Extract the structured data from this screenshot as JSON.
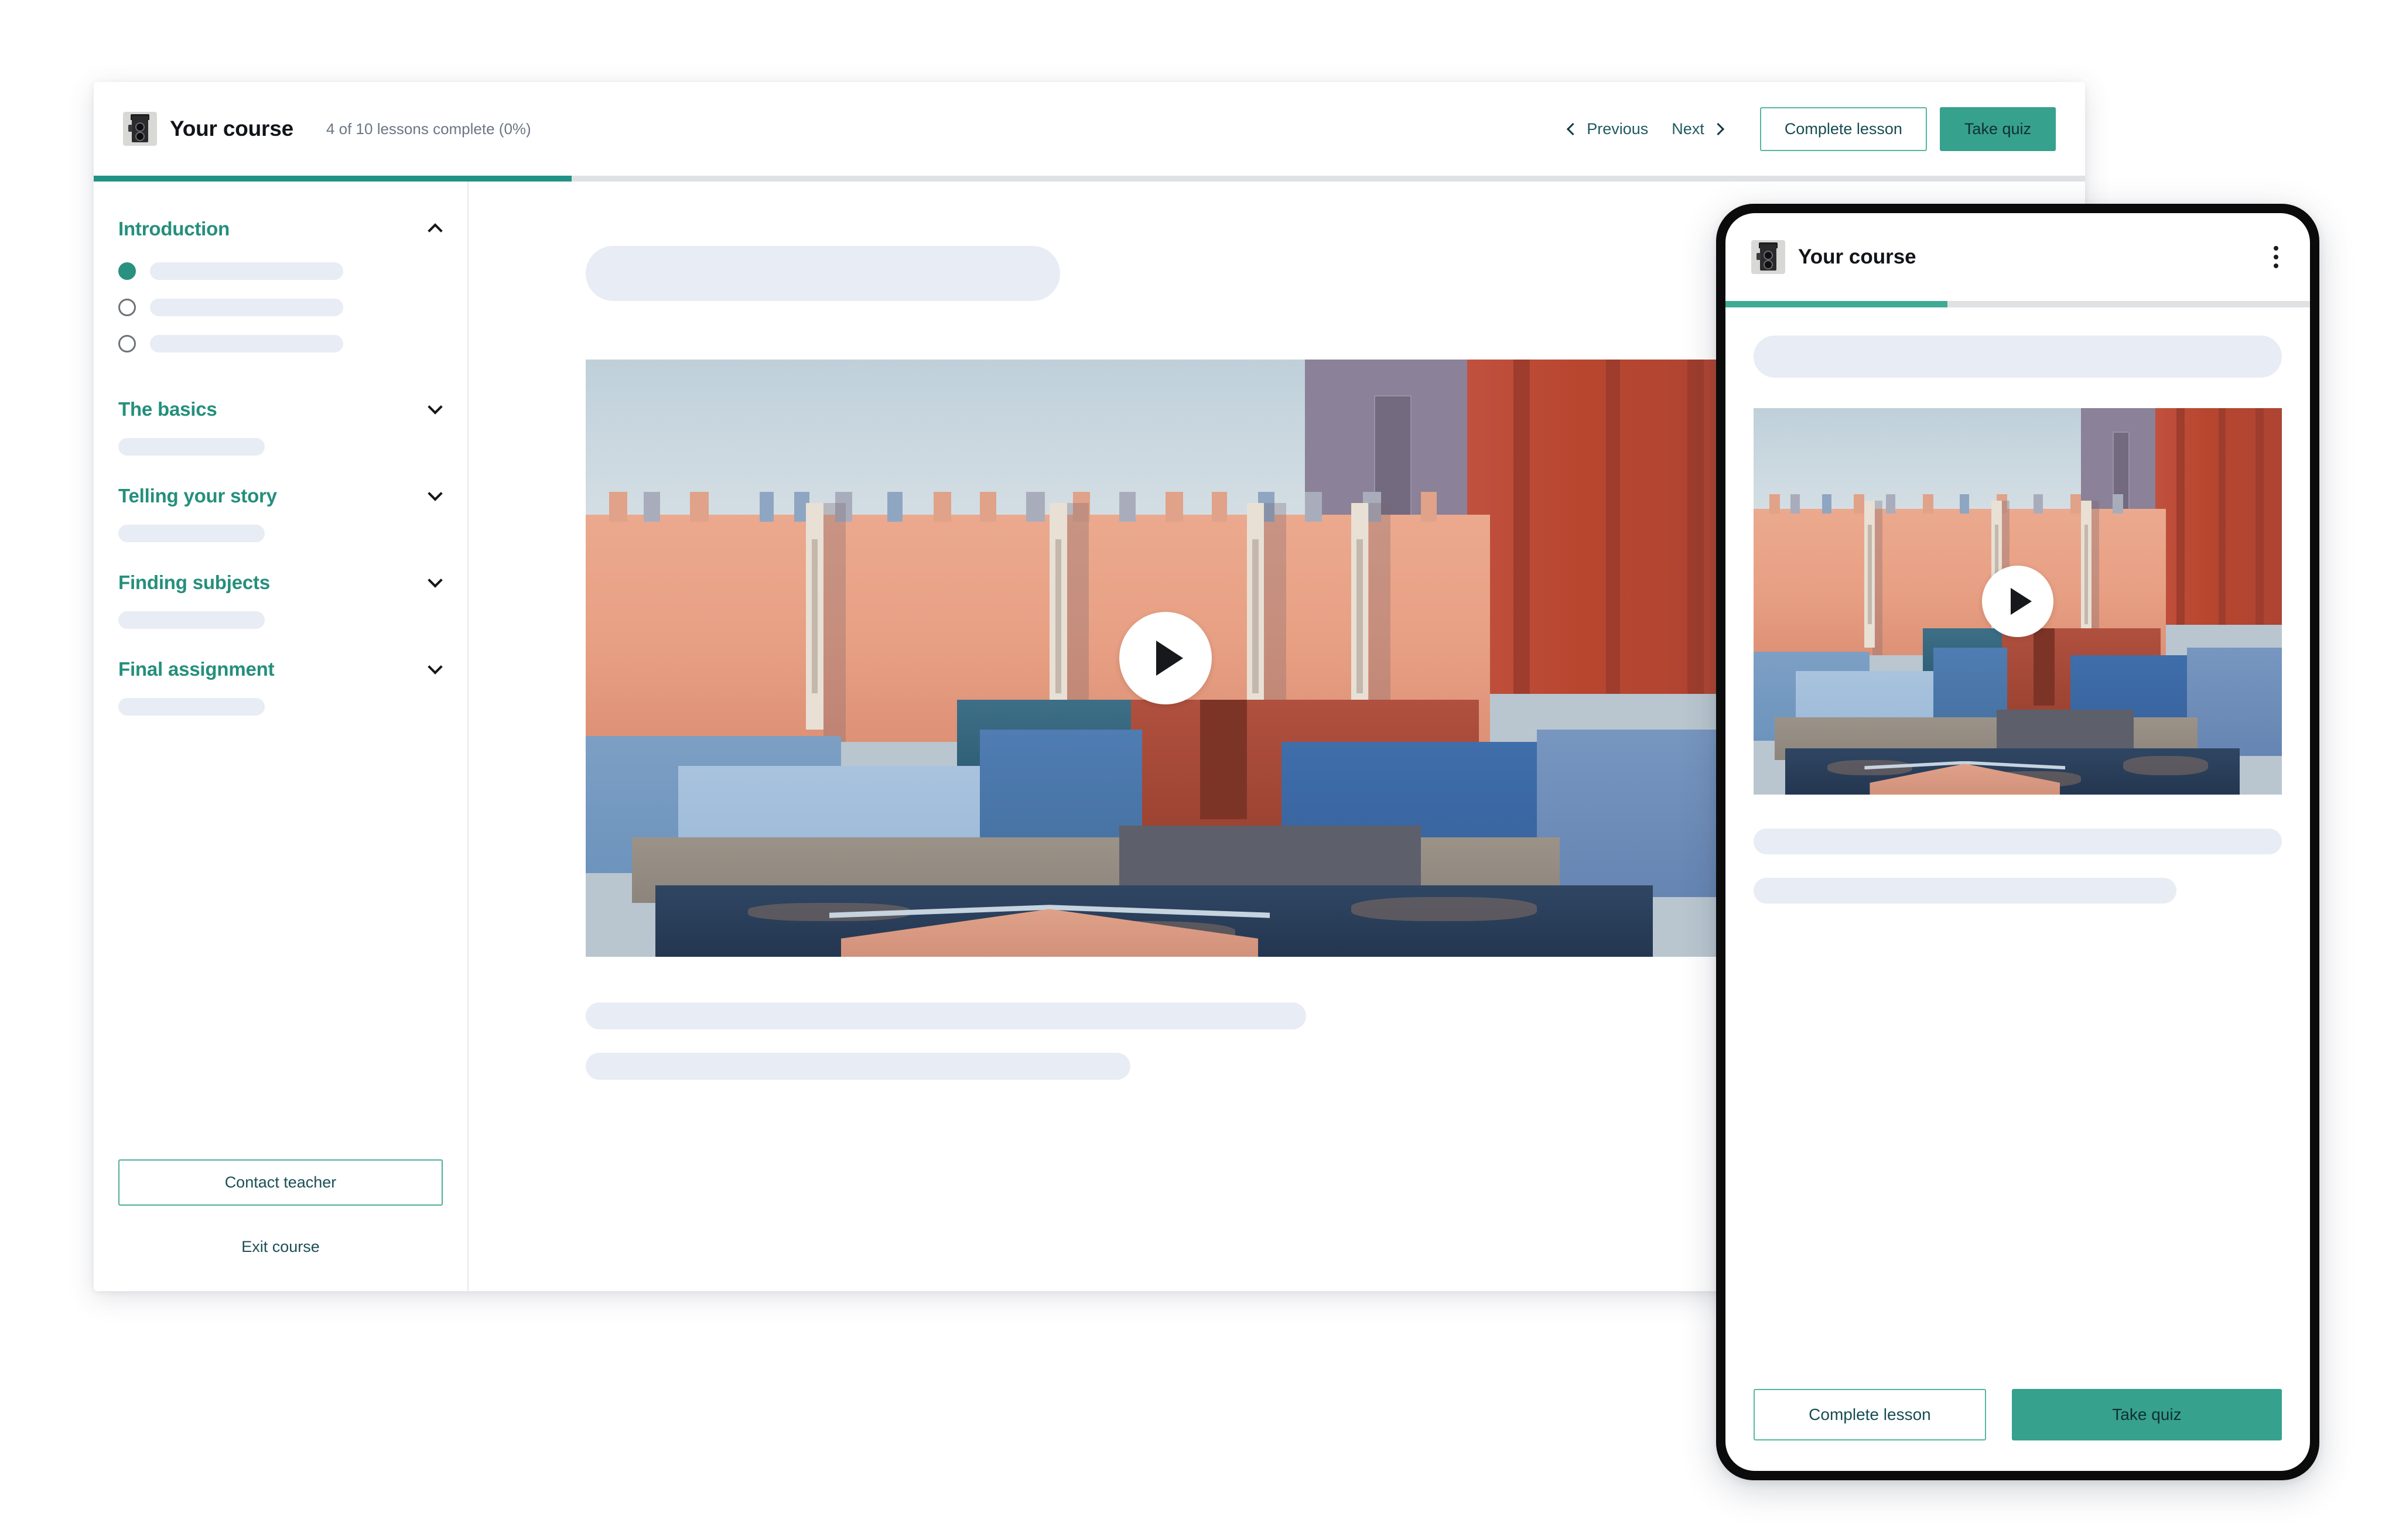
{
  "theme": {
    "accent_teal": "#36a18c",
    "accent_teal_dark": "#219386",
    "section_heading": "#248f7c",
    "skeleton": "#e8ecf4",
    "text_dark": "#111418",
    "muted_text": "#6c7684"
  },
  "desktop": {
    "header": {
      "logo_icon": "camera-icon",
      "course_title": "Your course",
      "progress_text": "4 of 10 lessons complete (0%)",
      "progress_percent": 24,
      "previous_label": "Previous",
      "next_label": "Next",
      "complete_lesson_label": "Complete lesson",
      "take_quiz_label": "Take quiz"
    },
    "sidebar": {
      "sections": [
        {
          "title": "Introduction",
          "expanded": true,
          "caret_icon": "chevron-up-icon",
          "lessons": [
            {
              "completed": true
            },
            {
              "completed": false
            },
            {
              "completed": false
            }
          ]
        },
        {
          "title": "The basics",
          "expanded": false,
          "caret_icon": "chevron-down-icon",
          "lessons": []
        },
        {
          "title": "Telling your story",
          "expanded": false,
          "caret_icon": "chevron-down-icon",
          "lessons": []
        },
        {
          "title": "Finding subjects",
          "expanded": false,
          "caret_icon": "chevron-down-icon",
          "lessons": []
        },
        {
          "title": "Final assignment",
          "expanded": false,
          "caret_icon": "chevron-down-icon",
          "lessons": []
        }
      ],
      "contact_teacher_label": "Contact teacher",
      "exit_course_label": "Exit course"
    },
    "main": {
      "video": {
        "play_icon": "play-icon",
        "description": "Pink and blue modernist architecture building with pool, La Muralla Roja style"
      }
    }
  },
  "phone": {
    "header": {
      "logo_icon": "camera-icon",
      "course_title": "Your course",
      "menu_icon": "kebab-menu-icon",
      "progress_percent": 38
    },
    "main": {
      "video": {
        "play_icon": "play-icon",
        "description": "Pink and blue modernist architecture building with pool, La Muralla Roja style"
      }
    },
    "footer": {
      "complete_lesson_label": "Complete lesson",
      "take_quiz_label": "Take quiz"
    }
  }
}
